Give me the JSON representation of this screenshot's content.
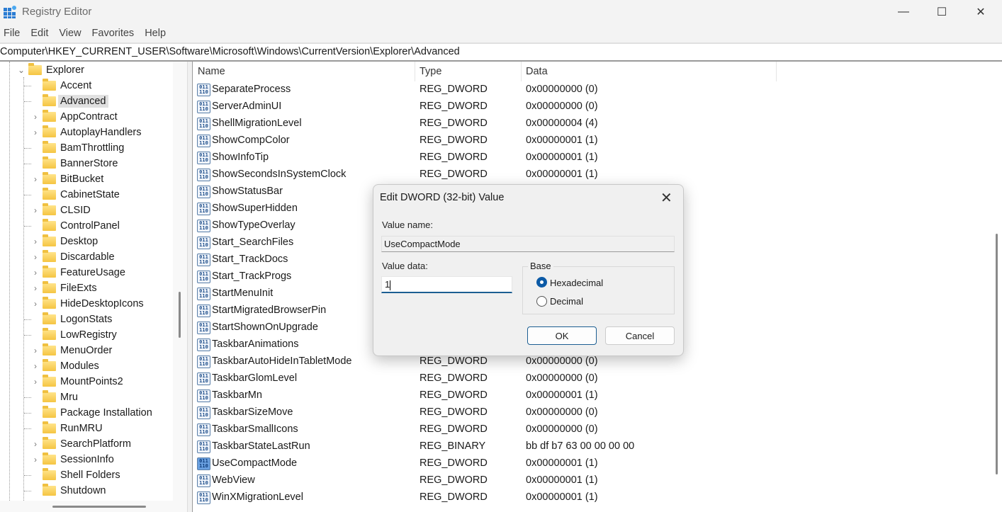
{
  "window": {
    "title": "Registry Editor",
    "minimize": "—",
    "maximize": "☐",
    "close": "✕"
  },
  "menu": [
    "File",
    "Edit",
    "View",
    "Favorites",
    "Help"
  ],
  "address": "Computer\\HKEY_CURRENT_USER\\Software\\Microsoft\\Windows\\CurrentVersion\\Explorer\\Advanced",
  "tree": {
    "parent": {
      "label": "Explorer",
      "expanded": true
    },
    "children": [
      {
        "label": "Accent",
        "expandable": false
      },
      {
        "label": "Advanced",
        "expandable": false,
        "selected": true
      },
      {
        "label": "AppContract",
        "expandable": true
      },
      {
        "label": "AutoplayHandlers",
        "expandable": true
      },
      {
        "label": "BamThrottling",
        "expandable": false
      },
      {
        "label": "BannerStore",
        "expandable": false
      },
      {
        "label": "BitBucket",
        "expandable": true
      },
      {
        "label": "CabinetState",
        "expandable": false
      },
      {
        "label": "CLSID",
        "expandable": true
      },
      {
        "label": "ControlPanel",
        "expandable": false
      },
      {
        "label": "Desktop",
        "expandable": true
      },
      {
        "label": "Discardable",
        "expandable": true
      },
      {
        "label": "FeatureUsage",
        "expandable": true
      },
      {
        "label": "FileExts",
        "expandable": true
      },
      {
        "label": "HideDesktopIcons",
        "expandable": true
      },
      {
        "label": "LogonStats",
        "expandable": false
      },
      {
        "label": "LowRegistry",
        "expandable": false
      },
      {
        "label": "MenuOrder",
        "expandable": true
      },
      {
        "label": "Modules",
        "expandable": true
      },
      {
        "label": "MountPoints2",
        "expandable": true
      },
      {
        "label": "Mru",
        "expandable": false
      },
      {
        "label": "Package Installation",
        "expandable": false
      },
      {
        "label": "RunMRU",
        "expandable": false
      },
      {
        "label": "SearchPlatform",
        "expandable": true
      },
      {
        "label": "SessionInfo",
        "expandable": true
      },
      {
        "label": "Shell Folders",
        "expandable": false
      },
      {
        "label": "Shutdown",
        "expandable": false
      }
    ]
  },
  "list": {
    "columns": [
      "Name",
      "Type",
      "Data"
    ],
    "rows": [
      {
        "name": "SeparateProcess",
        "type": "REG_DWORD",
        "data": "0x00000000 (0)"
      },
      {
        "name": "ServerAdminUI",
        "type": "REG_DWORD",
        "data": "0x00000000 (0)"
      },
      {
        "name": "ShellMigrationLevel",
        "type": "REG_DWORD",
        "data": "0x00000004 (4)"
      },
      {
        "name": "ShowCompColor",
        "type": "REG_DWORD",
        "data": "0x00000001 (1)"
      },
      {
        "name": "ShowInfoTip",
        "type": "REG_DWORD",
        "data": "0x00000001 (1)"
      },
      {
        "name": "ShowSecondsInSystemClock",
        "type": "REG_DWORD",
        "data": "0x00000001 (1)"
      },
      {
        "name": "ShowStatusBar",
        "type": "",
        "data": ""
      },
      {
        "name": "ShowSuperHidden",
        "type": "",
        "data": ""
      },
      {
        "name": "ShowTypeOverlay",
        "type": "",
        "data": ""
      },
      {
        "name": "Start_SearchFiles",
        "type": "",
        "data": ""
      },
      {
        "name": "Start_TrackDocs",
        "type": "",
        "data": ""
      },
      {
        "name": "Start_TrackProgs",
        "type": "",
        "data": ""
      },
      {
        "name": "StartMenuInit",
        "type": "",
        "data": ""
      },
      {
        "name": "StartMigratedBrowserPin",
        "type": "",
        "data": ""
      },
      {
        "name": "StartShownOnUpgrade",
        "type": "",
        "data": ""
      },
      {
        "name": "TaskbarAnimations",
        "type": "",
        "data": ""
      },
      {
        "name": "TaskbarAutoHideInTabletMode",
        "type": "REG_DWORD",
        "data": "0x00000000 (0)"
      },
      {
        "name": "TaskbarGlomLevel",
        "type": "REG_DWORD",
        "data": "0x00000000 (0)"
      },
      {
        "name": "TaskbarMn",
        "type": "REG_DWORD",
        "data": "0x00000001 (1)"
      },
      {
        "name": "TaskbarSizeMove",
        "type": "REG_DWORD",
        "data": "0x00000000 (0)"
      },
      {
        "name": "TaskbarSmallIcons",
        "type": "REG_DWORD",
        "data": "0x00000000 (0)"
      },
      {
        "name": "TaskbarStateLastRun",
        "type": "REG_BINARY",
        "data": "bb df b7 63 00 00 00 00"
      },
      {
        "name": "UseCompactMode",
        "type": "REG_DWORD",
        "data": "0x00000001 (1)",
        "selected": true
      },
      {
        "name": "WebView",
        "type": "REG_DWORD",
        "data": "0x00000001 (1)"
      },
      {
        "name": "WinXMigrationLevel",
        "type": "REG_DWORD",
        "data": "0x00000001 (1)"
      }
    ]
  },
  "dialog": {
    "title": "Edit DWORD (32-bit) Value",
    "value_name_label": "Value name:",
    "value_name": "UseCompactMode",
    "value_data_label": "Value data:",
    "value_data": "1",
    "base_label": "Base",
    "base_options": [
      {
        "label": "Hexadecimal",
        "checked": true
      },
      {
        "label": "Decimal",
        "checked": false
      }
    ],
    "ok": "OK",
    "cancel": "Cancel",
    "close": "✕"
  },
  "colors": {
    "accent": "#0c5aa6",
    "folder": "#f5c542"
  }
}
